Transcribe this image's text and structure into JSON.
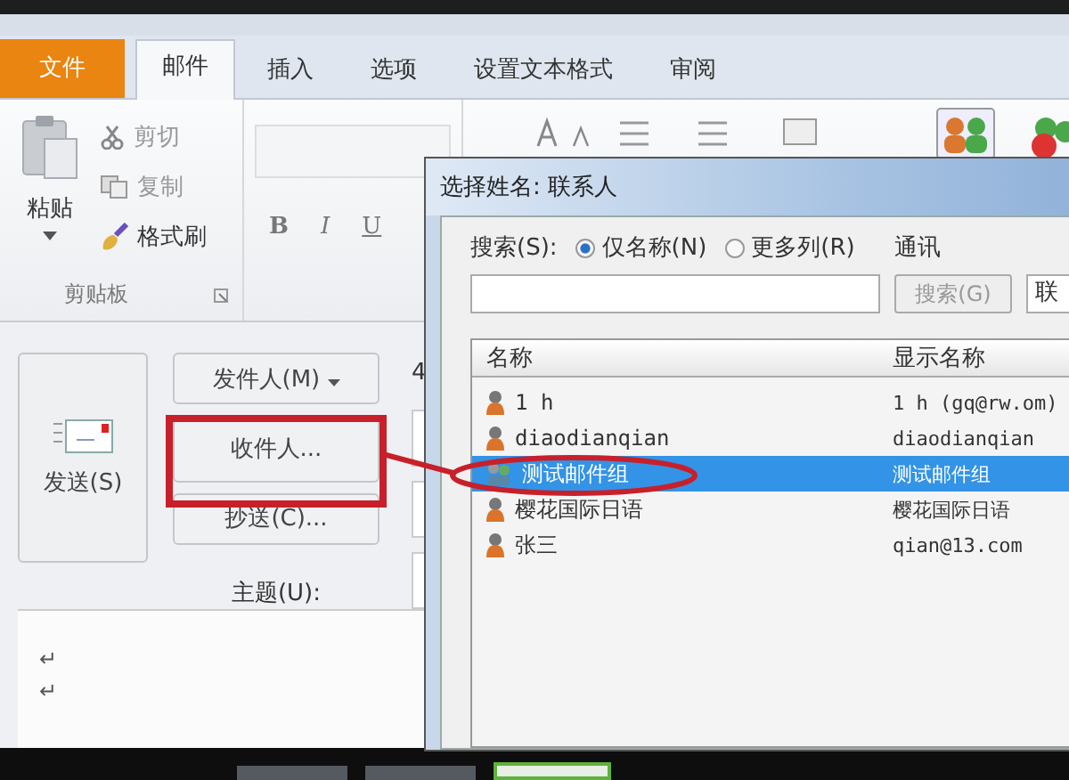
{
  "ribbon_tabs": [
    {
      "label": "文件",
      "kind": "file",
      "selected": false
    },
    {
      "label": "邮件",
      "kind": "tab",
      "selected": true
    },
    {
      "label": "插入",
      "kind": "tab",
      "selected": false
    },
    {
      "label": "选项",
      "kind": "tab",
      "selected": false
    },
    {
      "label": "设置文本格式",
      "kind": "tab",
      "selected": false
    },
    {
      "label": "审阅",
      "kind": "tab",
      "selected": false
    }
  ],
  "clipboard": {
    "paste": "粘贴",
    "cut": "剪切",
    "copy": "复制",
    "format_painter": "格式刷",
    "group_label": "剪贴板"
  },
  "font_group": {
    "bold": "B",
    "italic": "I",
    "underline": "U"
  },
  "compose": {
    "send": "发送(S)",
    "from": "发件人(M)",
    "to": "收件人...",
    "cc": "抄送(C)...",
    "subject_label": "主题(U):",
    "partial_text": "4",
    "body_marks": [
      "↵",
      "↵"
    ]
  },
  "dialog": {
    "title": "选择姓名: 联系人",
    "search_label": "搜索(S):",
    "search_options": [
      {
        "label": "仅名称(N)",
        "selected": true
      },
      {
        "label": "更多列(R)",
        "selected": false
      }
    ],
    "search_button": "搜索(G)",
    "address_book_label": "通讯",
    "address_book_value": "联",
    "columns": [
      "名称",
      "显示名称"
    ],
    "rows": [
      {
        "name": "1 h",
        "display": "1 h (gq@rw.om)",
        "kind": "contact",
        "selected": false
      },
      {
        "name": "diaodianqian",
        "display": "diaodianqian",
        "kind": "contact",
        "selected": false
      },
      {
        "name": "测试邮件组",
        "display": "测试邮件组",
        "kind": "group",
        "selected": true
      },
      {
        "name": "樱花国际日语",
        "display": "樱花国际日语",
        "kind": "contact",
        "selected": false
      },
      {
        "name": "张三",
        "display": "qian@13.com",
        "kind": "contact",
        "selected": false
      }
    ]
  }
}
